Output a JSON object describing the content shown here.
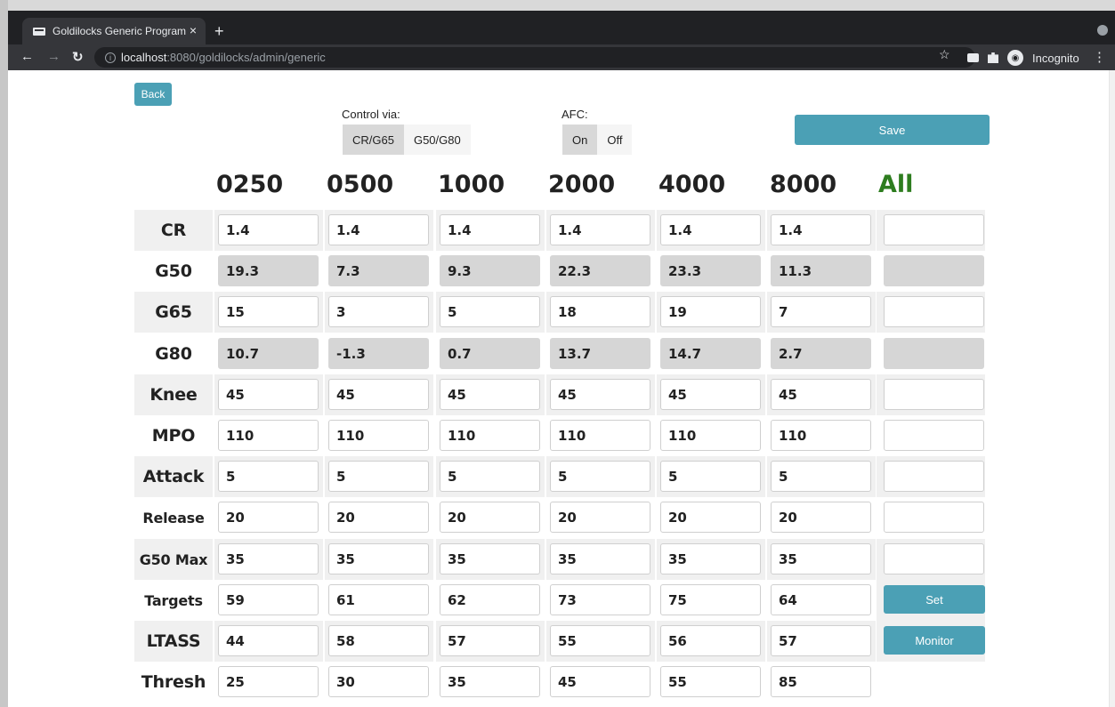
{
  "browser": {
    "tab_title": "Goldilocks Generic Program",
    "tab_close": "×",
    "new_tab": "+",
    "url_host": "localhost",
    "url_path": ":8080/goldilocks/admin/generic",
    "profile_label": "Incognito"
  },
  "page": {
    "back_label": "Back",
    "control_label": "Control via:",
    "control_options": [
      "CR/G65",
      "G50/G80"
    ],
    "afc_label": "AFC:",
    "afc_options": [
      "On",
      "Off"
    ],
    "save_label": "Save",
    "frequencies": [
      "0250",
      "0500",
      "1000",
      "2000",
      "4000",
      "8000",
      "All"
    ],
    "rows": [
      {
        "label": "CR",
        "values": [
          "1.4",
          "1.4",
          "1.4",
          "1.4",
          "1.4",
          "1.4"
        ],
        "all": ""
      },
      {
        "label": "G50",
        "values": [
          "19.3",
          "7.3",
          "9.3",
          "22.3",
          "23.3",
          "11.3"
        ],
        "all": ""
      },
      {
        "label": "G65",
        "values": [
          "15",
          "3",
          "5",
          "18",
          "19",
          "7"
        ],
        "all": ""
      },
      {
        "label": "G80",
        "values": [
          "10.7",
          "-1.3",
          "0.7",
          "13.7",
          "14.7",
          "2.7"
        ],
        "all": ""
      },
      {
        "label": "Knee",
        "values": [
          "45",
          "45",
          "45",
          "45",
          "45",
          "45"
        ],
        "all": ""
      },
      {
        "label": "MPO",
        "values": [
          "110",
          "110",
          "110",
          "110",
          "110",
          "110"
        ],
        "all": ""
      },
      {
        "label": "Attack",
        "values": [
          "5",
          "5",
          "5",
          "5",
          "5",
          "5"
        ],
        "all": ""
      },
      {
        "label": "Release",
        "values": [
          "20",
          "20",
          "20",
          "20",
          "20",
          "20"
        ],
        "all": ""
      },
      {
        "label": "G50 Max",
        "values": [
          "35",
          "35",
          "35",
          "35",
          "35",
          "35"
        ],
        "all": ""
      },
      {
        "label": "Targets",
        "values": [
          "59",
          "61",
          "62",
          "73",
          "75",
          "64"
        ],
        "button": "Set"
      },
      {
        "label": "LTASS",
        "values": [
          "44",
          "58",
          "57",
          "55",
          "56",
          "57"
        ],
        "button": "Monitor"
      },
      {
        "label": "Thresh",
        "values": [
          "25",
          "30",
          "35",
          "45",
          "55",
          "85"
        ]
      }
    ]
  },
  "colors": {
    "accent": "#4ba0b5",
    "all_header": "#2e7d1f",
    "readonly_cell": "#d6d6d6",
    "shade": "#f0f0f0"
  }
}
